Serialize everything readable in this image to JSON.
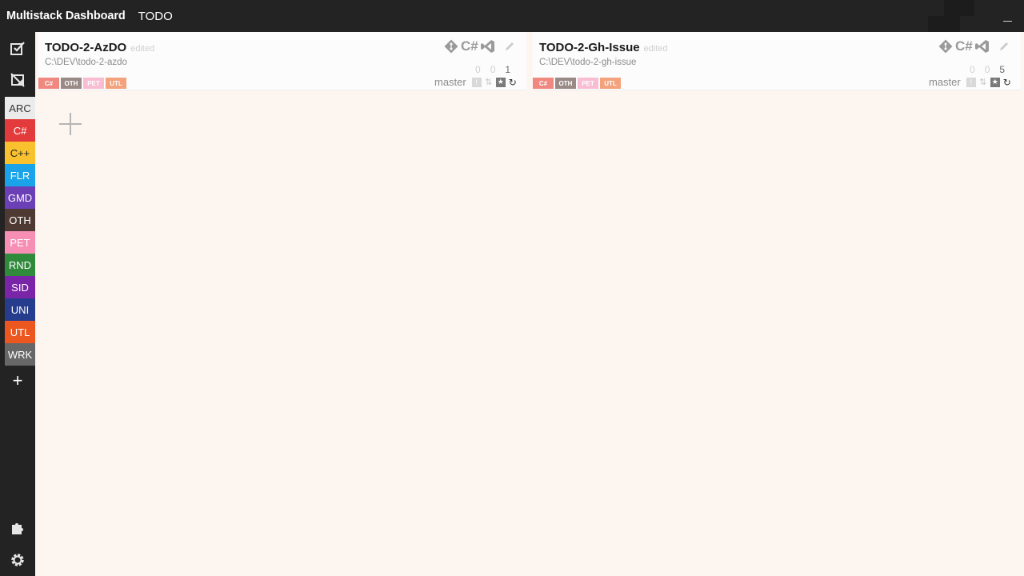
{
  "window": {
    "app_title": "Multistack Dashboard",
    "view_title": "TODO"
  },
  "sidebar": {
    "top_buttons": [
      {
        "name": "checklist-icon"
      },
      {
        "name": "hidden-projects-icon"
      }
    ],
    "categories": [
      {
        "label": "ARC",
        "color": "#ebebeb",
        "text_color": "#333333"
      },
      {
        "label": "C#",
        "color": "#e33b3b",
        "text_color": "#ffffff"
      },
      {
        "label": "C++",
        "color": "#f9c12e",
        "text_color": "#222222"
      },
      {
        "label": "FLR",
        "color": "#1aa3e8",
        "text_color": "#ffffff"
      },
      {
        "label": "GMD",
        "color": "#6b3fb5",
        "text_color": "#ffffff"
      },
      {
        "label": "OTH",
        "color": "#4e3a33",
        "text_color": "#ffffff"
      },
      {
        "label": "PET",
        "color": "#f78fb5",
        "text_color": "#ffffff"
      },
      {
        "label": "RND",
        "color": "#2f8a3c",
        "text_color": "#ffffff"
      },
      {
        "label": "SID",
        "color": "#7a25a8",
        "text_color": "#ffffff"
      },
      {
        "label": "UNI",
        "color": "#263c8c",
        "text_color": "#ffffff"
      },
      {
        "label": "UTL",
        "color": "#ec5720",
        "text_color": "#ffffff"
      },
      {
        "label": "WRK",
        "color": "#676767",
        "text_color": "#ffffff"
      }
    ],
    "add_label": "+",
    "bottom_buttons": [
      {
        "name": "plugin-icon"
      },
      {
        "name": "settings-icon"
      }
    ]
  },
  "projects": [
    {
      "title": "TODO-2-AzDO",
      "edited_label": "edited",
      "path": "C:\\DEV\\todo-2-azdo",
      "tags": [
        {
          "label": "C#",
          "color": "#f0887f"
        },
        {
          "label": "OTH",
          "color": "#9a8a85"
        },
        {
          "label": "PET",
          "color": "#f8bdd2"
        },
        {
          "label": "UTL",
          "color": "#f4a27c"
        }
      ],
      "language_label": "C#",
      "counts": [
        "0",
        "0",
        "1"
      ],
      "branch": "master"
    },
    {
      "title": "TODO-2-Gh-Issue",
      "edited_label": "edited",
      "path": "C:\\DEV\\todo-2-gh-issue",
      "tags": [
        {
          "label": "C#",
          "color": "#f0887f"
        },
        {
          "label": "OTH",
          "color": "#9a8a85"
        },
        {
          "label": "PET",
          "color": "#f8bdd2"
        },
        {
          "label": "UTL",
          "color": "#f4a27c"
        }
      ],
      "language_label": "C#",
      "counts": [
        "0",
        "0",
        "5"
      ],
      "branch": "master"
    }
  ],
  "colors": {
    "titlebar": "#232323",
    "sidebar": "#232323",
    "background": "#fdf5f0",
    "card": "#fcfcfc"
  }
}
